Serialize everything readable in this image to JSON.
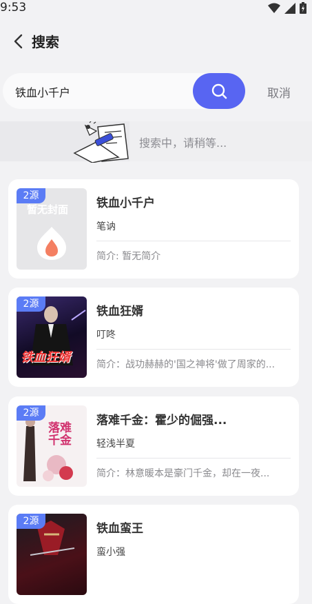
{
  "status": {
    "time": "9:53"
  },
  "header": {
    "title": "搜索"
  },
  "search": {
    "value": "铁血小千户",
    "cancel_label": "取消"
  },
  "searching": {
    "text": "搜索中，请稍等..."
  },
  "results": [
    {
      "badge": "2源",
      "title": "铁血小千户",
      "author": "笔讷",
      "intro": "简介: 暂无简介",
      "cover_text": "暂无封面"
    },
    {
      "badge": "2源",
      "title": "铁血狂婿",
      "author": "叮咚",
      "intro": "简介：战功赫赫的'国之神将'做了周家的...",
      "cover_text": "铁血狂婿"
    },
    {
      "badge": "2源",
      "title": "落难千金：霍少的倔强...",
      "author": "轻浅半夏",
      "intro": "简介：林意暖本是豪门千金，却在一夜...",
      "cover_text": "落难千金"
    },
    {
      "badge": "2源",
      "title": "铁血蛮王",
      "author": "蛮小强",
      "intro": "",
      "cover_text": ""
    }
  ],
  "colors": {
    "accent": "#5865f2",
    "badge": "#5b7cf5"
  }
}
